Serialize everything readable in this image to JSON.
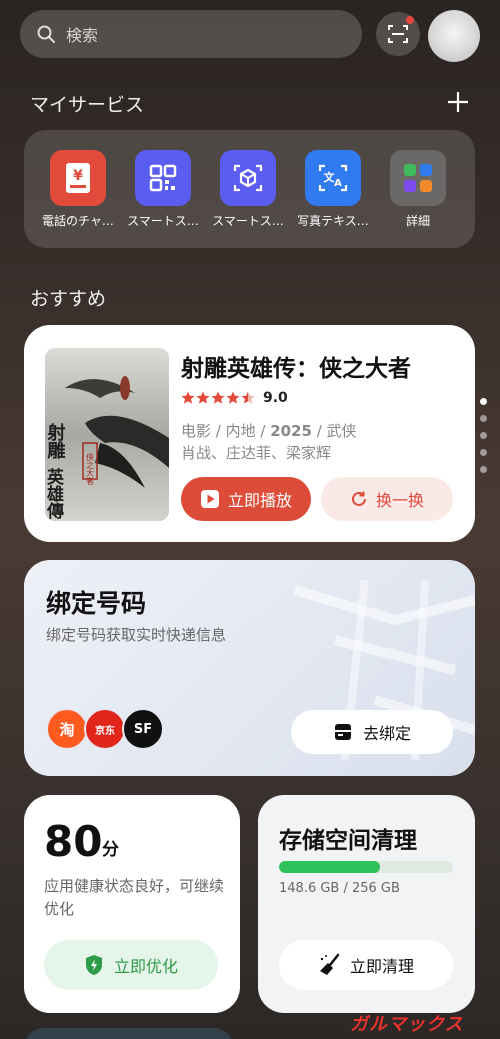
{
  "search": {
    "placeholder": "検索"
  },
  "my_services": {
    "title": "マイサービス",
    "items": [
      {
        "label": "電話のチャ…",
        "icon": "yen-receipt-icon",
        "color": "#e24a3b"
      },
      {
        "label": "スマートス…",
        "icon": "qr-code-icon",
        "color": "#5b5cf0"
      },
      {
        "label": "スマートス…",
        "icon": "scan-box-icon",
        "color": "#5b5cf0"
      },
      {
        "label": "写真テキス…",
        "icon": "translate-icon",
        "color": "#2f7bef"
      },
      {
        "label": "詳細",
        "icon": "more-apps-icon",
        "color": "#6b6968"
      }
    ]
  },
  "recommend": {
    "title": "おすすめ",
    "movie": {
      "title": "射雕英雄传：侠之大者",
      "rating": "9.0",
      "meta1_a": "电影 / 内地 / ",
      "meta1_year": "2025",
      "meta1_b": " / 武侠",
      "meta2": "肖战、庄达菲、梁家辉",
      "play_label": "立即播放",
      "swap_label": "换一换",
      "poster_text": "射雕英雄传",
      "poster_seal": "侠之大者"
    }
  },
  "bind": {
    "title": "绑定号码",
    "subtitle": "绑定号码获取实时快递信息",
    "button": "去绑定",
    "logos": [
      {
        "text": "淘",
        "name": "taobao-logo"
      },
      {
        "text": "京东",
        "name": "jd-logo"
      },
      {
        "text": "SF",
        "name": "sf-express-logo"
      }
    ]
  },
  "health": {
    "score": "80",
    "unit": "分",
    "desc": "应用健康状态良好，可继续优化",
    "button": "立即优化"
  },
  "storage": {
    "title": "存储空间清理",
    "usage": "148.6 GB / 256 GB",
    "fraction": 0.58,
    "button": "立即清理"
  },
  "watermark": "ガルマックス"
}
